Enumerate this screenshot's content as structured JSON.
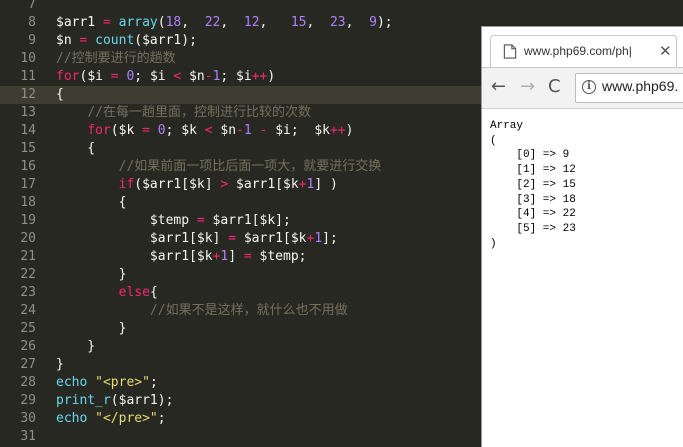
{
  "editor": {
    "lines": [
      {
        "n": "7",
        "tokens": []
      },
      {
        "n": "8",
        "tokens": [
          [
            "var",
            "$arr1 "
          ],
          [
            "op",
            "="
          ],
          [
            "punc",
            " "
          ],
          [
            "fn",
            "array"
          ],
          [
            "punc",
            "("
          ],
          [
            "num",
            "18"
          ],
          [
            "punc",
            ",  "
          ],
          [
            "num",
            "22"
          ],
          [
            "punc",
            ",  "
          ],
          [
            "num",
            "12"
          ],
          [
            "punc",
            ",   "
          ],
          [
            "num",
            "15"
          ],
          [
            "punc",
            ",  "
          ],
          [
            "num",
            "23"
          ],
          [
            "punc",
            ",  "
          ],
          [
            "num",
            "9"
          ],
          [
            "punc",
            ");"
          ]
        ]
      },
      {
        "n": "9",
        "tokens": [
          [
            "var",
            "$n "
          ],
          [
            "op",
            "="
          ],
          [
            "punc",
            " "
          ],
          [
            "fn",
            "count"
          ],
          [
            "punc",
            "("
          ],
          [
            "var",
            "$arr1"
          ],
          [
            "punc",
            ");"
          ]
        ]
      },
      {
        "n": "10",
        "tokens": [
          [
            "cm",
            "//控制要进行的趟数"
          ]
        ]
      },
      {
        "n": "11",
        "tokens": [
          [
            "kw",
            "for"
          ],
          [
            "punc",
            "("
          ],
          [
            "var",
            "$i "
          ],
          [
            "op",
            "="
          ],
          [
            "punc",
            " "
          ],
          [
            "num",
            "0"
          ],
          [
            "punc",
            "; "
          ],
          [
            "var",
            "$i "
          ],
          [
            "op",
            "<"
          ],
          [
            "punc",
            " "
          ],
          [
            "var",
            "$n"
          ],
          [
            "op",
            "-"
          ],
          [
            "num",
            "1"
          ],
          [
            "punc",
            "; "
          ],
          [
            "var",
            "$i"
          ],
          [
            "op",
            "++"
          ],
          [
            "punc",
            ")"
          ]
        ]
      },
      {
        "n": "12",
        "active": true,
        "tokens": [
          [
            "punc",
            "{"
          ]
        ]
      },
      {
        "n": "13",
        "tokens": [
          [
            "punc",
            "    "
          ],
          [
            "cm",
            "//在每一趟里面，控制进行比较的次数"
          ]
        ]
      },
      {
        "n": "14",
        "tokens": [
          [
            "punc",
            "    "
          ],
          [
            "kw",
            "for"
          ],
          [
            "punc",
            "("
          ],
          [
            "var",
            "$k "
          ],
          [
            "op",
            "="
          ],
          [
            "punc",
            " "
          ],
          [
            "num",
            "0"
          ],
          [
            "punc",
            "; "
          ],
          [
            "var",
            "$k "
          ],
          [
            "op",
            "<"
          ],
          [
            "punc",
            " "
          ],
          [
            "var",
            "$n"
          ],
          [
            "op",
            "-"
          ],
          [
            "num",
            "1"
          ],
          [
            "punc",
            " "
          ],
          [
            "op",
            "-"
          ],
          [
            "punc",
            " "
          ],
          [
            "var",
            "$i"
          ],
          [
            "punc",
            ";  "
          ],
          [
            "var",
            "$k"
          ],
          [
            "op",
            "++"
          ],
          [
            "punc",
            ")"
          ]
        ]
      },
      {
        "n": "15",
        "tokens": [
          [
            "punc",
            "    {"
          ]
        ]
      },
      {
        "n": "16",
        "tokens": [
          [
            "punc",
            "        "
          ],
          [
            "cm",
            "//如果前面一项比后面一项大，就要进行交换"
          ]
        ]
      },
      {
        "n": "17",
        "tokens": [
          [
            "punc",
            "        "
          ],
          [
            "kw",
            "if"
          ],
          [
            "punc",
            "("
          ],
          [
            "var",
            "$arr1"
          ],
          [
            "punc",
            "["
          ],
          [
            "var",
            "$k"
          ],
          [
            "punc",
            "] "
          ],
          [
            "op",
            ">"
          ],
          [
            "punc",
            " "
          ],
          [
            "var",
            "$arr1"
          ],
          [
            "punc",
            "["
          ],
          [
            "var",
            "$k"
          ],
          [
            "op",
            "+"
          ],
          [
            "num",
            "1"
          ],
          [
            "punc",
            "] )"
          ]
        ]
      },
      {
        "n": "18",
        "tokens": [
          [
            "punc",
            "        {"
          ]
        ]
      },
      {
        "n": "19",
        "tokens": [
          [
            "punc",
            "            "
          ],
          [
            "var",
            "$temp "
          ],
          [
            "op",
            "="
          ],
          [
            "punc",
            " "
          ],
          [
            "var",
            "$arr1"
          ],
          [
            "punc",
            "["
          ],
          [
            "var",
            "$k"
          ],
          [
            "punc",
            "];"
          ]
        ]
      },
      {
        "n": "20",
        "tokens": [
          [
            "punc",
            "            "
          ],
          [
            "var",
            "$arr1"
          ],
          [
            "punc",
            "["
          ],
          [
            "var",
            "$k"
          ],
          [
            "punc",
            "] "
          ],
          [
            "op",
            "="
          ],
          [
            "punc",
            " "
          ],
          [
            "var",
            "$arr1"
          ],
          [
            "punc",
            "["
          ],
          [
            "var",
            "$k"
          ],
          [
            "op",
            "+"
          ],
          [
            "num",
            "1"
          ],
          [
            "punc",
            "];"
          ]
        ]
      },
      {
        "n": "21",
        "tokens": [
          [
            "punc",
            "            "
          ],
          [
            "var",
            "$arr1"
          ],
          [
            "punc",
            "["
          ],
          [
            "var",
            "$k"
          ],
          [
            "op",
            "+"
          ],
          [
            "num",
            "1"
          ],
          [
            "punc",
            "] "
          ],
          [
            "op",
            "="
          ],
          [
            "punc",
            " "
          ],
          [
            "var",
            "$temp"
          ],
          [
            "punc",
            ";"
          ]
        ]
      },
      {
        "n": "22",
        "tokens": [
          [
            "punc",
            "        }"
          ]
        ]
      },
      {
        "n": "23",
        "tokens": [
          [
            "punc",
            "        "
          ],
          [
            "kw",
            "else"
          ],
          [
            "punc",
            "{"
          ]
        ]
      },
      {
        "n": "24",
        "tokens": [
          [
            "punc",
            "            "
          ],
          [
            "cm",
            "//如果不是这样，就什么也不用做"
          ]
        ]
      },
      {
        "n": "25",
        "tokens": [
          [
            "punc",
            "        }"
          ]
        ]
      },
      {
        "n": "26",
        "tokens": [
          [
            "punc",
            "    }"
          ]
        ]
      },
      {
        "n": "27",
        "tokens": [
          [
            "punc",
            "}"
          ]
        ]
      },
      {
        "n": "28",
        "tokens": [
          [
            "fn",
            "echo"
          ],
          [
            "punc",
            " "
          ],
          [
            "str",
            "\"<pre>\""
          ],
          [
            "punc",
            ";"
          ]
        ]
      },
      {
        "n": "29",
        "tokens": [
          [
            "fn",
            "print_r"
          ],
          [
            "punc",
            "("
          ],
          [
            "var",
            "$arr1"
          ],
          [
            "punc",
            ");"
          ]
        ]
      },
      {
        "n": "30",
        "tokens": [
          [
            "fn",
            "echo"
          ],
          [
            "punc",
            " "
          ],
          [
            "str",
            "\"</pre>\""
          ],
          [
            "punc",
            ";"
          ]
        ]
      },
      {
        "n": "31",
        "tokens": []
      }
    ]
  },
  "colors": {
    "editor_bg": "#272822",
    "active_line": "#3e3d32",
    "keyword": "#f92672",
    "number": "#ae81ff",
    "function": "#66d9ef",
    "string": "#e6db74",
    "comment": "#75715e"
  },
  "browser": {
    "tab": {
      "icon": "page-icon",
      "title": "www.php69.com/ph|",
      "close_label": "✕"
    },
    "toolbar": {
      "back_label": "←",
      "forward_label": "→",
      "reload_label": "C",
      "info_icon_label": "i",
      "url": "www.php69."
    },
    "output_lines": [
      "Array",
      "(",
      "    [0] => 9",
      "    [1] => 12",
      "    [2] => 15",
      "    [3] => 18",
      "    [4] => 22",
      "    [5] => 23",
      ")"
    ]
  }
}
